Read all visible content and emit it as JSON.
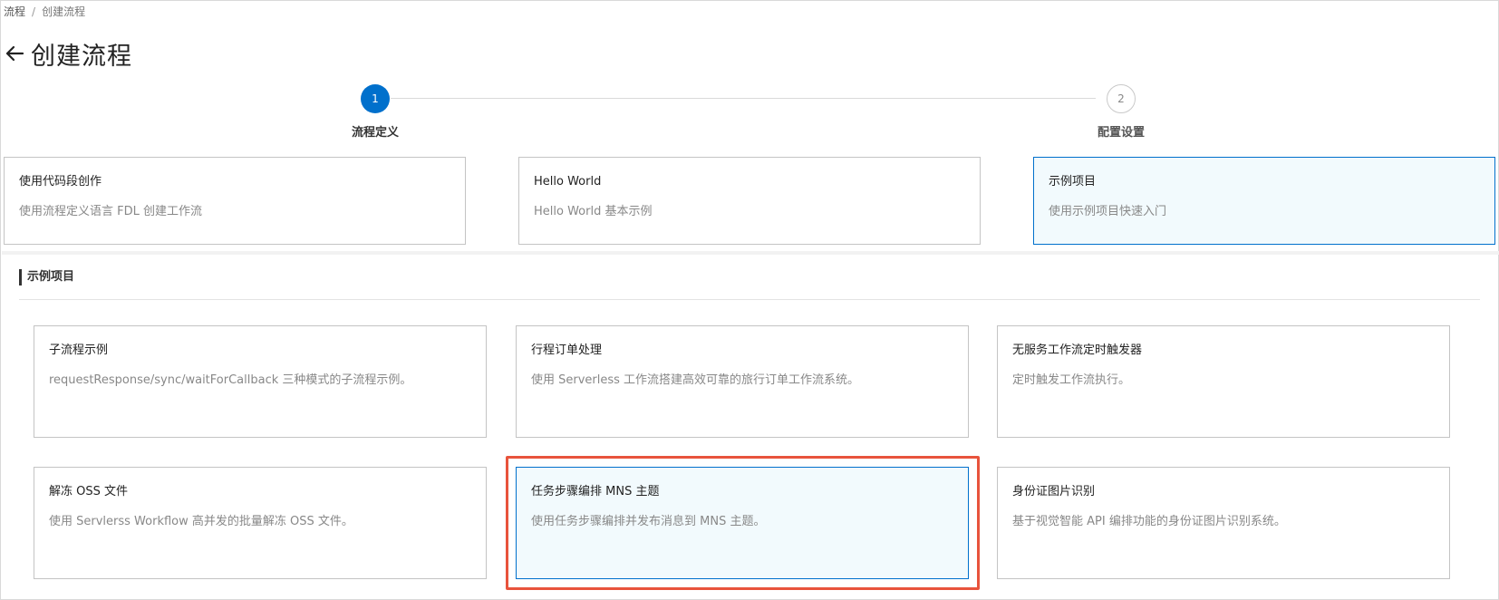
{
  "breadcrumb": {
    "root": "流程",
    "separator": "/",
    "current": "创建流程"
  },
  "page": {
    "title": "创建流程",
    "back_icon": "arrow-left-icon"
  },
  "steps": [
    {
      "number": "1",
      "label": "流程定义",
      "state": "active"
    },
    {
      "number": "2",
      "label": "配置设置",
      "state": "inactive"
    }
  ],
  "options": [
    {
      "title": "使用代码段创作",
      "desc": "使用流程定义语言 FDL 创建工作流",
      "selected": false
    },
    {
      "title": "Hello World",
      "desc": "Hello World 基本示例",
      "selected": false
    },
    {
      "title": "示例项目",
      "desc": "使用示例项目快速入门",
      "selected": true
    }
  ],
  "section": {
    "title": "示例项目"
  },
  "examples": [
    {
      "title": "子流程示例",
      "desc": "requestResponse/sync/waitForCallback 三种模式的子流程示例。",
      "selected": false
    },
    {
      "title": "行程订单处理",
      "desc": "使用 Serverless 工作流搭建高效可靠的旅行订单工作流系统。",
      "selected": false
    },
    {
      "title": "无服务工作流定时触发器",
      "desc": "定时触发工作流执行。",
      "selected": false
    },
    {
      "title": "解冻 OSS 文件",
      "desc": "使用 Servlerss Workflow 高并发的批量解冻 OSS 文件。",
      "selected": false
    },
    {
      "title": "任务步骤编排 MNS 主题",
      "desc": "使用任务步骤编排并发布消息到 MNS 主题。",
      "selected": true
    },
    {
      "title": "身份证图片识别",
      "desc": "基于视觉智能 API 编排功能的身份证图片识别系统。",
      "selected": false
    }
  ],
  "colors": {
    "accent": "#0070cc",
    "selected_bg": "#f2fafd",
    "highlight": "#e8533c"
  }
}
